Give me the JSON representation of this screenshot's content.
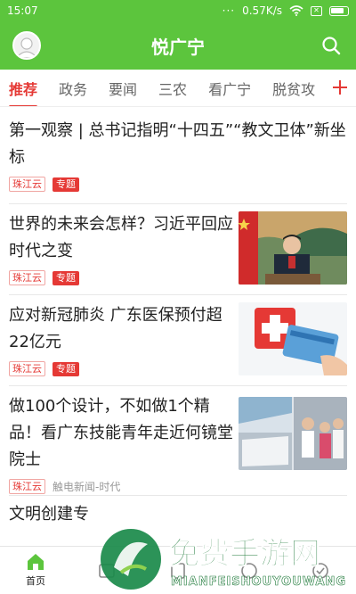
{
  "status_bar": {
    "time": "15:07",
    "speed": "0.57K/s"
  },
  "header": {
    "title": "悦广宁"
  },
  "tabs": [
    "推荐",
    "政务",
    "要闻",
    "三农",
    "看广宁",
    "脱贫攻"
  ],
  "feed": [
    {
      "headline": "第一观察 | 总书记指明“十四五”“教文卫体”新坐标",
      "source": "珠江云",
      "tag": "专题"
    },
    {
      "headline": "世界的未来会怎样？习近平回应时代之变",
      "source": "珠江云",
      "tag": "专题"
    },
    {
      "headline": "应对新冠肺炎 广东医保预付超22亿元",
      "source": "珠江云",
      "tag": "专题"
    },
    {
      "headline": "做100个设计，不如做1个精品！看广东技能青年走近何镜堂院士",
      "source": "珠江云",
      "source2": "触电新闻-时代"
    },
    {
      "headline": "文明创建专"
    }
  ],
  "bottom_nav": {
    "home": "首页"
  },
  "watermark": {
    "cn": "免费手游网",
    "en": "MIANFEISHOUYOUWANG"
  },
  "colors": {
    "brand_green": "#5cc53d",
    "accent_red": "#e53935"
  }
}
